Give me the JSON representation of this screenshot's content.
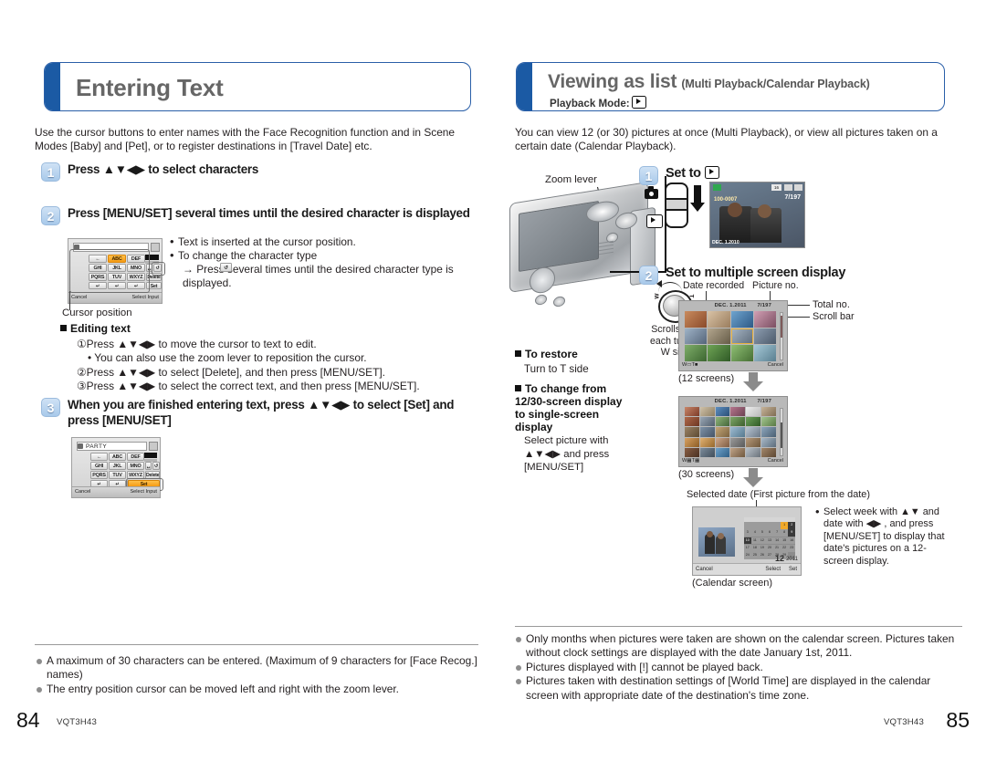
{
  "left_page": {
    "banner": {
      "title": "Entering Text"
    },
    "intro": "Use the cursor buttons to enter names with the Face Recognition function and in Scene Modes [Baby] and [Pet], or to register destinations in [Travel Date] etc.",
    "step1": {
      "num": "1",
      "text": "Press ▲▼◀▶ to select characters"
    },
    "step2": {
      "num": "2",
      "text": "Press [MENU/SET] several times until the desired character is displayed"
    },
    "step2_notes": [
      "Text is inserted at the cursor position.",
      "To change the character type"
    ],
    "step2_subnote": "→ Press  several times until the desired character type is displayed.",
    "cursor_caption": "Cursor position",
    "editing_heading": "Editing text",
    "editing_items": [
      "①Press ▲▼◀▶ to move the cursor to text to edit.",
      "• You can also use the zoom lever to reposition the cursor.",
      "②Press ▲▼◀▶ to select [Delete], and then press [MENU/SET].",
      "③Press ▲▼◀▶ to select the correct text, and then press [MENU/SET]."
    ],
    "step3": {
      "num": "3",
      "text": "When you are finished entering text, press ▲▼◀▶ to select [Set] and press [MENU/SET]"
    },
    "keyboard": {
      "entry_value": "",
      "entry_value_filled": "PARTY",
      "keys": [
        "←",
        "ABC",
        "DEF",
        "GHI",
        "JKL",
        "MNO",
        "PQRS",
        "TUV",
        "WXYZ"
      ],
      "nav_keys": [
        "↵",
        "↵",
        "↵"
      ],
      "space_key": "␣",
      "shift_key": "↺",
      "delete_key": "Delete",
      "set_key": "Set",
      "cancel_label": "Cancel",
      "select_label": "Select",
      "input_label": "Input"
    },
    "notes": [
      "A maximum of 30 characters can be entered. (Maximum of 9 characters for [Face Recog.] names)",
      "The entry position cursor can be moved left and right with the zoom lever."
    ],
    "folio": {
      "number": "84",
      "code": "VQT3H43"
    }
  },
  "right_page": {
    "banner": {
      "title": "Viewing as list",
      "subtitle": "(Multi Playback/Calendar Playback)",
      "mode_label": "Playback Mode:",
      "mode_icon": "playback-icon"
    },
    "intro": "You can view 12 (or 30) pictures at once (Multi Playback), or view all pictures taken on a certain date (Calendar Playback).",
    "zoom_lever_label": "Zoom lever",
    "step1": {
      "num": "1",
      "text": "Set to"
    },
    "step2": {
      "num": "2",
      "text": "Set to multiple screen display"
    },
    "dial_caption": "Scrolls with each turn to W side",
    "labels": {
      "date_recorded": "Date recorded",
      "picture_no": "Picture no.",
      "total_no": "Total no.",
      "scroll_bar": "Scroll bar"
    },
    "lcd12": {
      "date": "DEC. 1.2011",
      "picno": "7/197",
      "cancel": "Cancel",
      "caption": "(12 screens)"
    },
    "lcd30": {
      "date": "DEC. 1.2011",
      "picno": "7/197",
      "cancel": "Cancel",
      "caption": "(30 screens)"
    },
    "single_lcd": {
      "picno": "7/197",
      "folder": "100-0007",
      "date": "DEC. 1.2010"
    },
    "to_restore": {
      "heading": "To restore",
      "body": "Turn to T side"
    },
    "to_change": {
      "heading": "To change from 12/30-screen display to single-screen display",
      "body": "Select picture with ▲▼◀▶ and press [MENU/SET]"
    },
    "calendar": {
      "selected_date_label": "Selected date (First picture from the date)",
      "caption": "(Calendar screen)",
      "cancel": "Cancel",
      "select": "Select",
      "set": "Set",
      "note": "Select week with ▲▼ and date with ◀▶ , and press [MENU/SET] to display that date's pictures on a 12-screen display.",
      "month": "12",
      "year": "2011",
      "weekday_headers": [
        "SUN",
        "MON",
        "TUE",
        "WED",
        "THU",
        "FRI",
        "SAT"
      ],
      "days": [
        "",
        "",
        "",
        "1",
        "2",
        "3",
        "4",
        "5",
        "6",
        "7",
        "8",
        "9",
        "10",
        "11",
        "12",
        "13",
        "14",
        "15",
        "16",
        "17",
        "18",
        "19",
        "20",
        "21",
        "22",
        "23",
        "24",
        "25",
        "26",
        "27",
        "28",
        "29",
        "30",
        "31"
      ],
      "selected_day": "1"
    },
    "notes": [
      "Only months when pictures were taken are shown on the calendar screen. Pictures taken without clock settings are displayed with the date January 1st, 2011.",
      "Pictures displayed with [!] cannot be played back.",
      "Pictures taken with destination settings of [World Time] are displayed in the calendar screen with appropriate date of the destination's time zone."
    ],
    "folio": {
      "number": "85",
      "code": "VQT3H43"
    }
  },
  "colors": {
    "banner_border": "#2a5fa8",
    "banner_tab": "#1b5aa4",
    "title_gray": "#666666",
    "amber": "#f59b13"
  }
}
